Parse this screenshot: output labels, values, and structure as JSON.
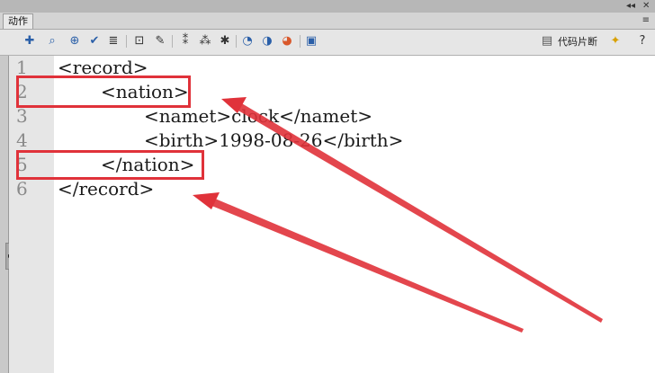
{
  "panel": {
    "tab_label": "动作",
    "menu_glyph": "≡",
    "collapse_glyph": "◂◂",
    "close_glyph": "✕"
  },
  "toolbar": {
    "icons": [
      "add-statement-icon",
      "find-icon",
      "target-icon",
      "check-syntax-icon",
      "auto-format-icon",
      "code-hint-icon",
      "debug-icon",
      "collapse-between-braces-icon",
      "collapse-selection-icon",
      "expand-all-icon",
      "apply-block-comment-icon",
      "apply-line-comment-icon",
      "remove-comment-icon",
      "toggle-toolbox-icon"
    ],
    "snippets_label": "代码片断",
    "wand_glyph": "✦",
    "help_glyph": "?"
  },
  "editor": {
    "lines": [
      {
        "num": "1",
        "text": "<record>"
      },
      {
        "num": "2",
        "text": "<nation>"
      },
      {
        "num": "3",
        "text": "<namet>clock</namet>"
      },
      {
        "num": "4",
        "text": "<birth>1998-08-26</birth>"
      },
      {
        "num": "5",
        "text": "</nation>"
      },
      {
        "num": "6",
        "text": "</record>"
      }
    ]
  },
  "annotation_colors": {
    "highlight": "#e0323a"
  }
}
